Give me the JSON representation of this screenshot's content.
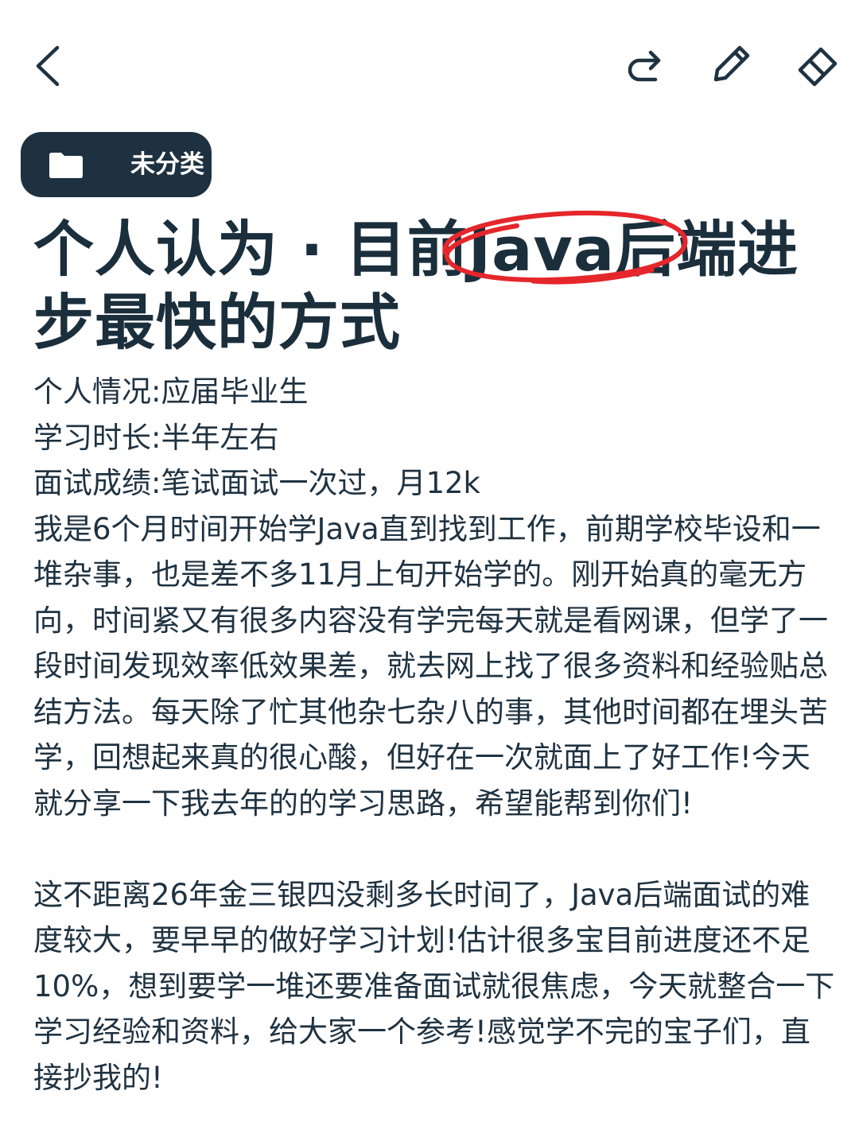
{
  "toolbar": {
    "back_icon": "chevron-left-icon",
    "redo_icon": "redo-icon",
    "edit_icon": "pencil-icon",
    "erase_icon": "eraser-icon",
    "icon_color": "#1f3241"
  },
  "category": {
    "icon": "folder-icon",
    "label": "未分类",
    "background": "#1e3140"
  },
  "note": {
    "title": "个人认为 · 目前Java后端进步最快的方式",
    "highlight_color": "#e5262b",
    "lines": [
      "个人情况:应届毕业生",
      "学习时长:半年左右",
      "面试成绩:笔试面试一次过，月12k"
    ],
    "paragraphs": [
      "我是6个月时间开始学Java直到找到工作，前期学校毕设和一堆杂事，也是差不多11月上旬开始学的。刚开始真的毫无方向，时间紧又有很多内容没有学完每天就是看网课，但学了一段时间发现效率低效果差，就去网上找了很多资料和经验贴总结方法。每天除了忙其他杂七杂八的事，其他时间都在埋头苦学，回想起来真的很心酸，但好在一次就面上了好工作!今天就分享一下我去年的的学习思路，希望能帮到你们!",
      "这不距离26年金三银四没剩多长时间了，Java后端面试的难度较大，要早早的做好学习计划!估计很多宝目前进度还不足10%，想到要学一堆还要准备面试就很焦虑，今天就整合一下学习经验和资料，给大家一个参考!感觉学不完的宝子们，直接抄我的!"
    ]
  }
}
